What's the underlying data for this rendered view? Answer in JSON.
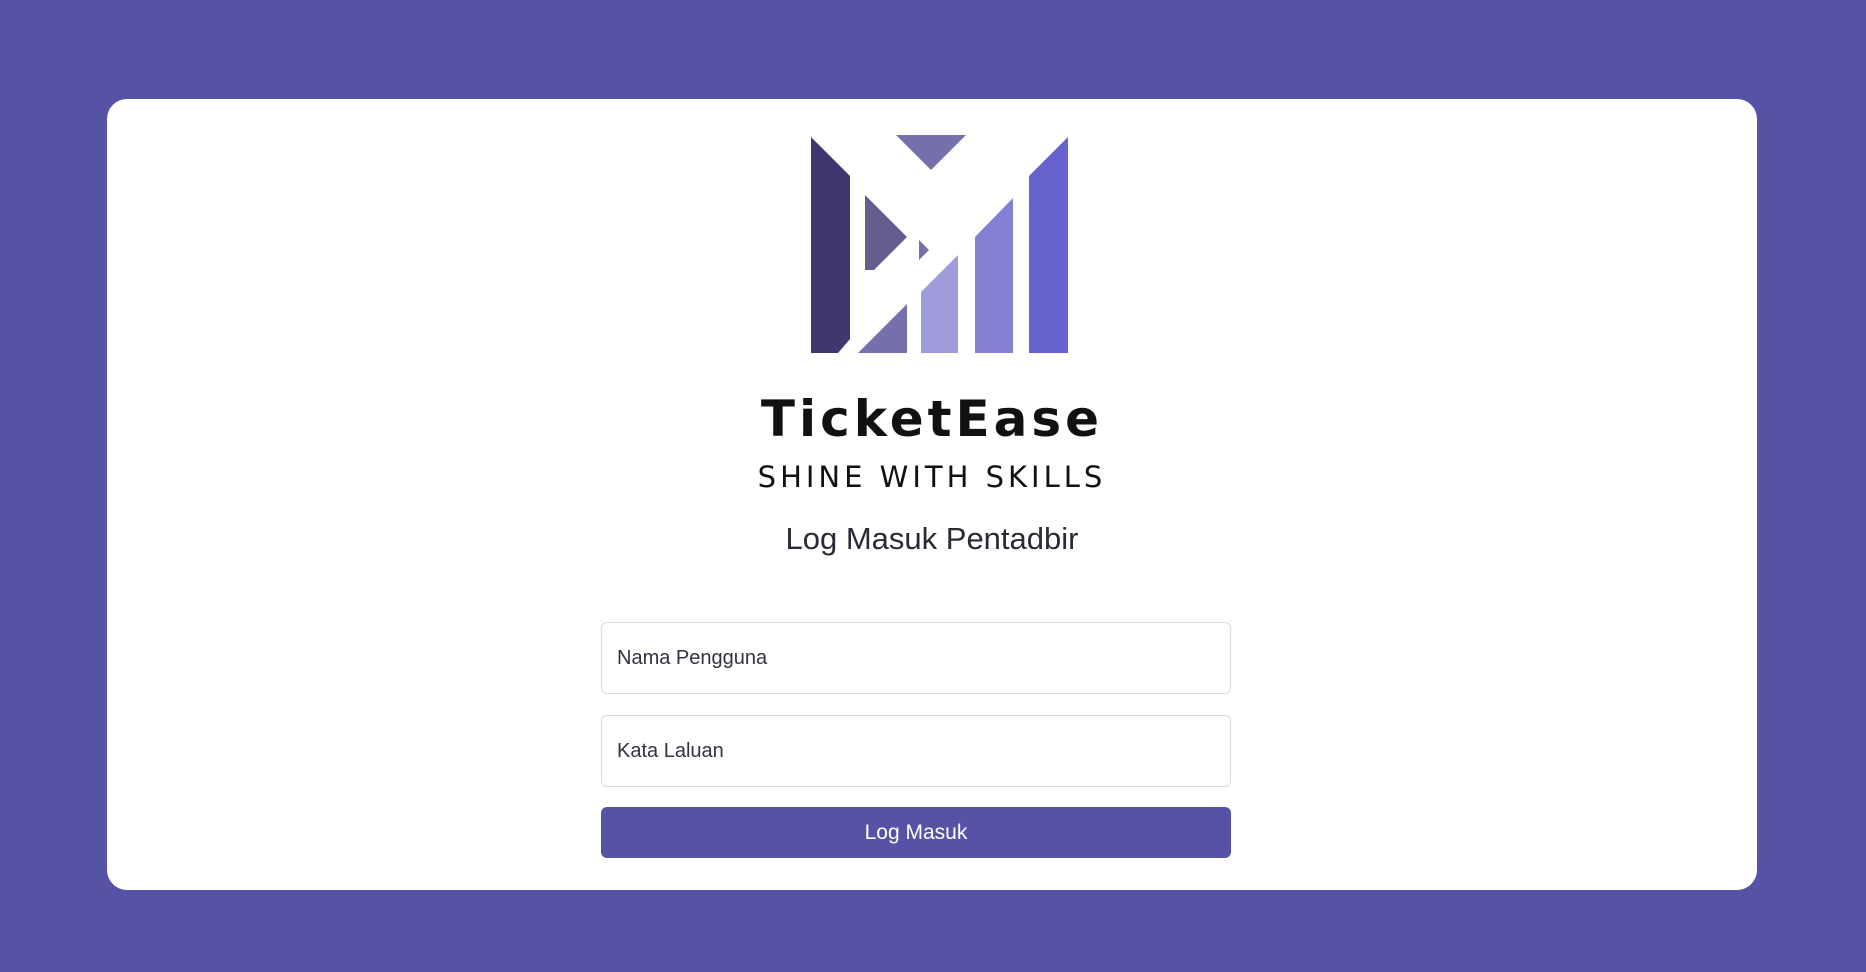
{
  "brand": {
    "name": "TicketEase",
    "tagline": "SHINE WITH SKILLS",
    "logo_icon": "ticketease-m-logo-icon"
  },
  "login_form": {
    "title": "Log Masuk Pentadbir",
    "username_placeholder": "Nama Pengguna",
    "password_placeholder": "Kata Laluan",
    "submit_label": "Log Masuk"
  },
  "colors": {
    "background": "#5653a7",
    "card": "#ffffff",
    "button": "#5653a7",
    "logo_shades": [
      "#3f376f",
      "#665c8d",
      "#7570ac",
      "#9f9cdb",
      "#8481d4",
      "#6862cf"
    ]
  }
}
